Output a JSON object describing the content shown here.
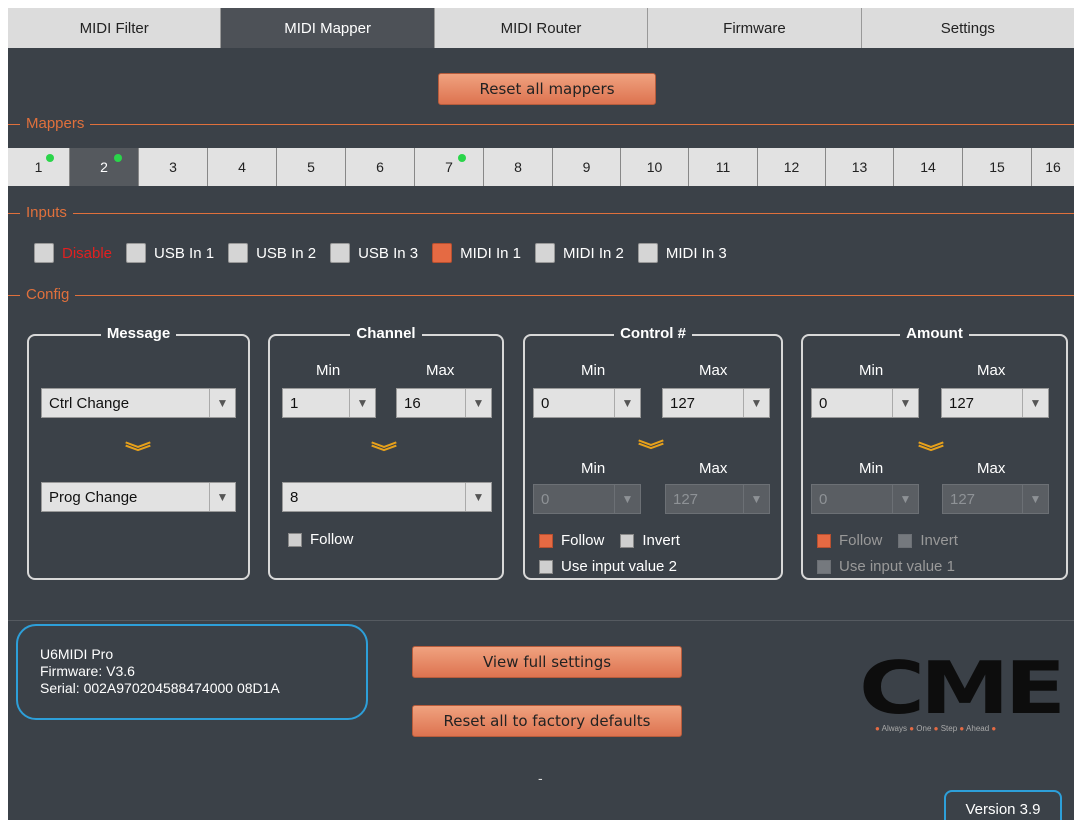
{
  "tabs": [
    {
      "label": "MIDI Filter",
      "active": false
    },
    {
      "label": "MIDI Mapper",
      "active": true
    },
    {
      "label": "MIDI Router",
      "active": false
    },
    {
      "label": "Firmware",
      "active": false
    },
    {
      "label": "Settings",
      "active": false
    }
  ],
  "buttons": {
    "reset_mappers": "Reset all mappers",
    "view_full": "View full settings",
    "reset_factory": "Reset all to factory defaults"
  },
  "sections": {
    "mappers": "Mappers",
    "inputs": "Inputs",
    "config": "Config"
  },
  "mappers": [
    {
      "label": "1",
      "dot": true
    },
    {
      "label": "2",
      "dot": true
    },
    {
      "label": "3",
      "dot": false
    },
    {
      "label": "4",
      "dot": false
    },
    {
      "label": "5",
      "dot": false
    },
    {
      "label": "6",
      "dot": false
    },
    {
      "label": "7",
      "dot": true
    },
    {
      "label": "8",
      "dot": false
    },
    {
      "label": "9",
      "dot": false
    },
    {
      "label": "10",
      "dot": false
    },
    {
      "label": "11",
      "dot": false
    },
    {
      "label": "12",
      "dot": false
    },
    {
      "label": "13",
      "dot": false
    },
    {
      "label": "14",
      "dot": false
    },
    {
      "label": "15",
      "dot": false
    },
    {
      "label": "16",
      "dot": false
    }
  ],
  "active_mapper": "2",
  "inputs": [
    {
      "label": "Disable",
      "checked": false
    },
    {
      "label": "USB In 1",
      "checked": false
    },
    {
      "label": "USB In 2",
      "checked": false
    },
    {
      "label": "USB In 3",
      "checked": false
    },
    {
      "label": "MIDI In 1",
      "checked": true
    },
    {
      "label": "MIDI In 2",
      "checked": false
    },
    {
      "label": "MIDI In 3",
      "checked": false
    }
  ],
  "config": {
    "message": {
      "title": "Message",
      "from": "Ctrl Change",
      "to": "Prog Change"
    },
    "channel": {
      "title": "Channel",
      "min_label": "Min",
      "max_label": "Max",
      "min": "1",
      "max": "16",
      "to": "8",
      "follow": "Follow"
    },
    "control": {
      "title": "Control #",
      "min_label": "Min",
      "max_label": "Max",
      "min": "0",
      "max": "127",
      "out_min": "0",
      "out_max": "127",
      "follow": "Follow",
      "invert": "Invert",
      "use_input": "Use input value 2"
    },
    "amount": {
      "title": "Amount",
      "min_label": "Min",
      "max_label": "Max",
      "min": "0",
      "max": "127",
      "out_min": "0",
      "out_max": "127",
      "follow": "Follow",
      "invert": "Invert",
      "use_input": "Use input value 1"
    }
  },
  "device": {
    "name": "U6MIDI Pro",
    "firmware": "Firmware: V3.6",
    "serial": "Serial: 002A970204588474000 08D1A"
  },
  "logo": {
    "text": "CME",
    "tagline": [
      "Always",
      "One",
      "Step",
      "Ahead"
    ]
  },
  "footer_dash": "-",
  "version": "Version 3.9",
  "colors": {
    "accent": "#e0703c",
    "background": "#3b4148",
    "info_border": "#2d9fd9",
    "active_dot": "#2ad54a"
  }
}
